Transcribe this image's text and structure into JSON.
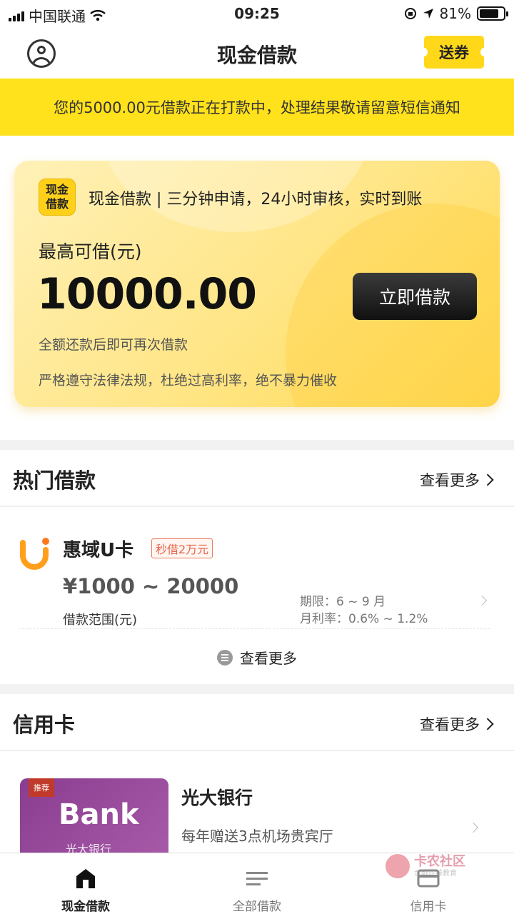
{
  "status_bar": {
    "carrier": "中国联通",
    "time": "09:25",
    "battery": "81%",
    "battery_level": 0.81
  },
  "header": {
    "title": "现金借款",
    "coupon_label": "送券"
  },
  "notice": {
    "text": "您的5000.00元借款正在打款中，处理结果敬请留意短信通知"
  },
  "hero": {
    "logo_line1": "现金",
    "logo_line2": "借款",
    "slogan": "现金借款 | 三分钟申请，24小时审核，实时到账",
    "max_label": "最高可借(元)",
    "amount": "10000.00",
    "borrow_button": "立即借款",
    "note1": "全额还款后即可再次借款",
    "note2": "严格遵守法律法规，杜绝过高利率，绝不暴力催收"
  },
  "hot_loans": {
    "title": "热门借款",
    "more": "查看更多",
    "items": [
      {
        "name": "惠域U卡",
        "tag": "秒借2万元",
        "range": "¥1000 ~ 20000",
        "range_label": "借款范围(元)",
        "term": "期限：6 ~ 9 月",
        "rate": "月利率：0.6% ~ 1.2%"
      }
    ],
    "see_more": "查看更多"
  },
  "credit_cards": {
    "title": "信用卡",
    "more": "查看更多",
    "items": [
      {
        "badge": "推荐",
        "card_word": "Bank",
        "card_bank_cn": "光大银行",
        "name": "光大银行",
        "desc": "每年赠送3点机场贵宾厅"
      }
    ]
  },
  "watermark": {
    "title": "卡农社区",
    "subtitle": "金融在线教育"
  },
  "tabbar": {
    "tabs": [
      {
        "label": "现金借款",
        "icon": "home-icon",
        "active": true
      },
      {
        "label": "全部借款",
        "icon": "list-icon",
        "active": false
      },
      {
        "label": "信用卡",
        "icon": "card-icon",
        "active": false
      }
    ]
  },
  "colors": {
    "accent_yellow": "#ffe11c",
    "dark_button": "#1a1a1a",
    "tag_red": "#e8634a"
  }
}
